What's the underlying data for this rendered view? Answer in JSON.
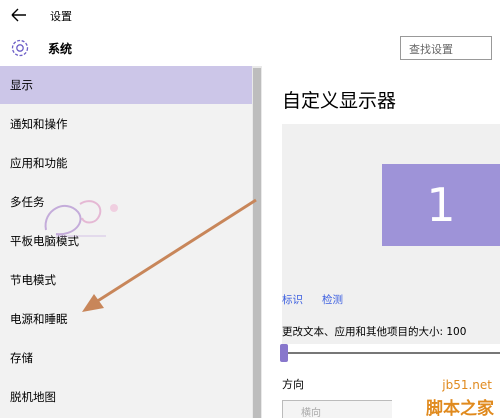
{
  "window": {
    "title": "设置"
  },
  "header": {
    "title": "系统",
    "search_placeholder": "查找设置"
  },
  "sidebar": {
    "items": [
      {
        "label": "显示",
        "active": true
      },
      {
        "label": "通知和操作",
        "active": false
      },
      {
        "label": "应用和功能",
        "active": false
      },
      {
        "label": "多任务",
        "active": false
      },
      {
        "label": "平板电脑模式",
        "active": false
      },
      {
        "label": "节电模式",
        "active": false
      },
      {
        "label": "电源和睡眠",
        "active": false
      },
      {
        "label": "存储",
        "active": false
      },
      {
        "label": "脱机地图",
        "active": false
      }
    ]
  },
  "main": {
    "title": "自定义显示器",
    "monitor_number": "1",
    "identify_link": "标识",
    "detect_link": "检测",
    "size_label": "更改文本、应用和其他项目的大小: 100",
    "size_value_percent": 0,
    "orientation_label": "方向",
    "orientation_value": "横向"
  },
  "watermark": {
    "url": "jb51.net",
    "name": "脚本之家"
  },
  "colors": {
    "accent": "#9e93d8",
    "active_item": "#ccc6e8",
    "link": "#3b5ee0",
    "arrow": "#c8865a"
  },
  "icons": {
    "back": "arrow-left-icon",
    "settings": "gear-icon"
  }
}
